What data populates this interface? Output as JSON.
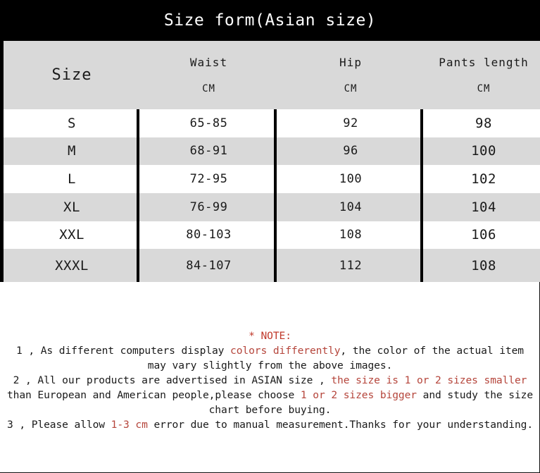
{
  "title": "Size form(Asian size)",
  "table": {
    "headers": [
      {
        "name": "Size",
        "unit": ""
      },
      {
        "name": "Waist",
        "unit": "CM"
      },
      {
        "name": "Hip",
        "unit": "CM"
      },
      {
        "name": "Pants length",
        "unit": "CM"
      }
    ],
    "rows": [
      {
        "size": "S",
        "waist": "65-85",
        "hip": "92",
        "pants": "98"
      },
      {
        "size": "M",
        "waist": "68-91",
        "hip": "96",
        "pants": "100"
      },
      {
        "size": "L",
        "waist": "72-95",
        "hip": "100",
        "pants": "102"
      },
      {
        "size": "XL",
        "waist": "76-99",
        "hip": "104",
        "pants": "104"
      },
      {
        "size": "XXL",
        "waist": "80-103",
        "hip": "108",
        "pants": "106"
      },
      {
        "size": "XXXL",
        "waist": "84-107",
        "hip": "112",
        "pants": "108"
      }
    ]
  },
  "notes": {
    "heading": "* NOTE:",
    "item1_a": "1 , As different computers display ",
    "item1_hl": "colors differently",
    "item1_b": ", the color of the actual item may vary slightly from the above images.",
    "item2_a": "2 , All our products are advertised in ASIAN size , ",
    "item2_hl1": "the size is 1 or 2 sizes smaller",
    "item2_b": " than European and American people,please choose ",
    "item2_hl2": "1 or 2 sizes bigger",
    "item2_c": " and study the size chart before buying.",
    "item3_a": "3 , Please allow ",
    "item3_hl": "1-3 cm",
    "item3_b": " error due to manual measurement.Thanks for your understanding."
  },
  "colors": {
    "title_bar": "#000000",
    "header_bg": "#d9d9d9",
    "stripe_grey": "#d9d9d9",
    "stripe_white": "#ffffff",
    "note_red": "#b5453b",
    "note_heading_red": "#c0392b"
  }
}
